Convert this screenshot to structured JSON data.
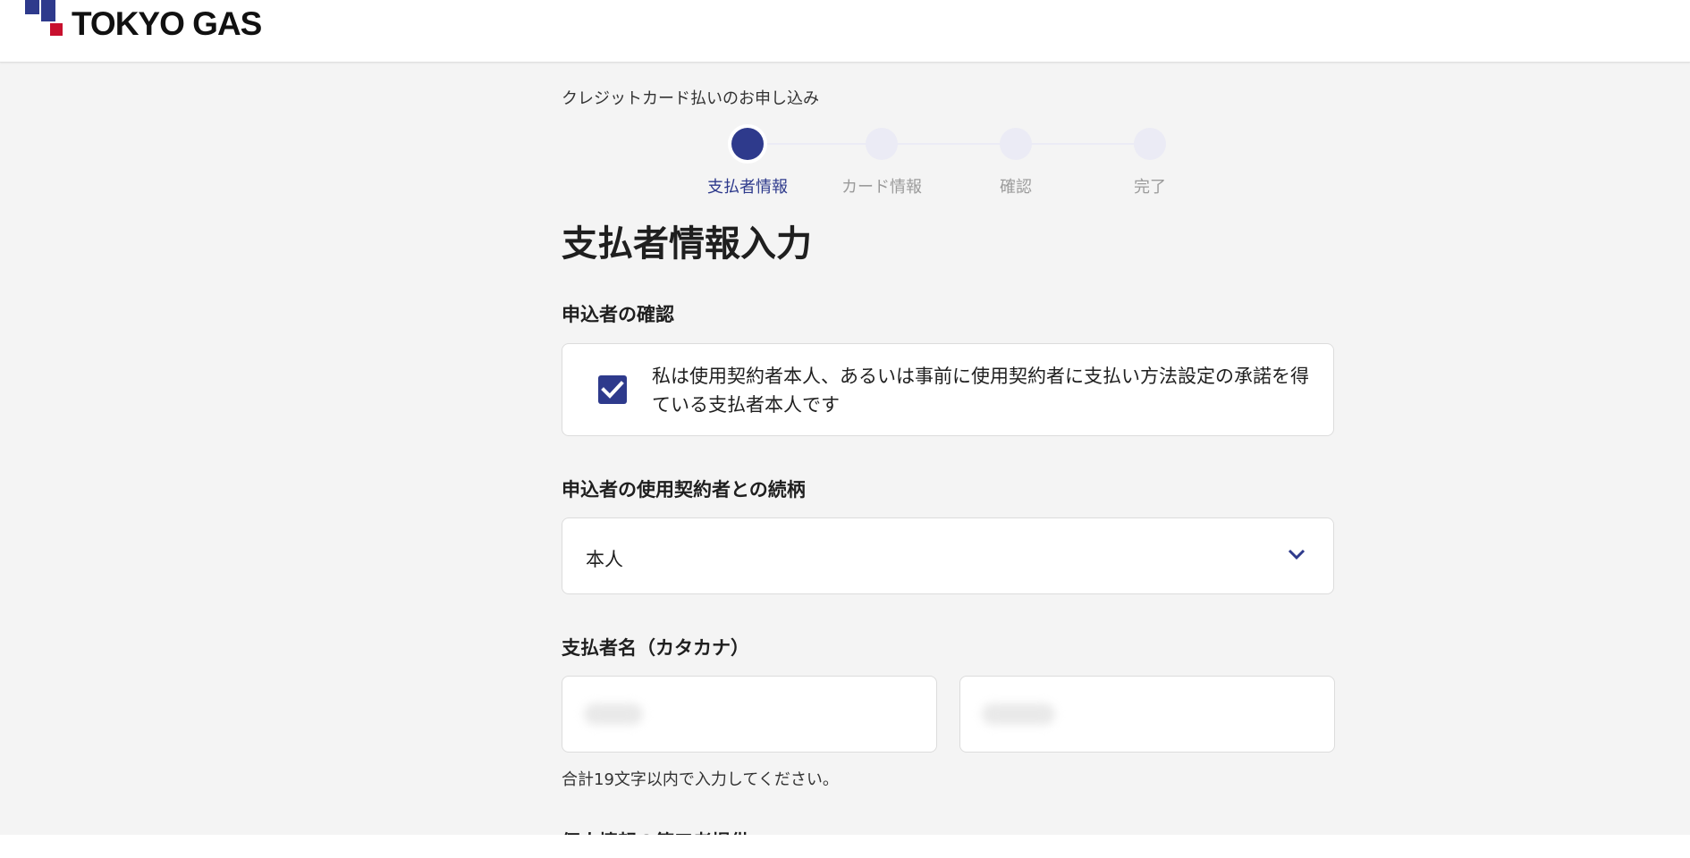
{
  "header": {
    "logo_text": "TOKYO GAS",
    "brand_colors": {
      "navy": "#2e3a8c",
      "red": "#c8102e"
    }
  },
  "app_title": "クレジットカード払いのお申し込み",
  "stepper": {
    "steps": [
      {
        "label": "支払者情報",
        "state": "active"
      },
      {
        "label": "カード情報",
        "state": "upcoming"
      },
      {
        "label": "確認",
        "state": "upcoming"
      },
      {
        "label": "完了",
        "state": "upcoming"
      }
    ]
  },
  "page_title": "支払者情報入力",
  "applicant_confirmation": {
    "label": "申込者の確認",
    "checkbox_checked": true,
    "consent_text": "私は使用契約者本人、あるいは事前に使用契約者に支払い方法設定の承諾を得ている支払者本人です"
  },
  "relationship": {
    "label": "申込者の使用契約者との続柄",
    "selected_value": "本人",
    "icon": "chevron-down-icon"
  },
  "payer_name": {
    "label": "支払者名（カタカナ）",
    "hint": "合計19文字以内で入力してください。"
  },
  "next_section_label": "個人情報の第三者提供"
}
